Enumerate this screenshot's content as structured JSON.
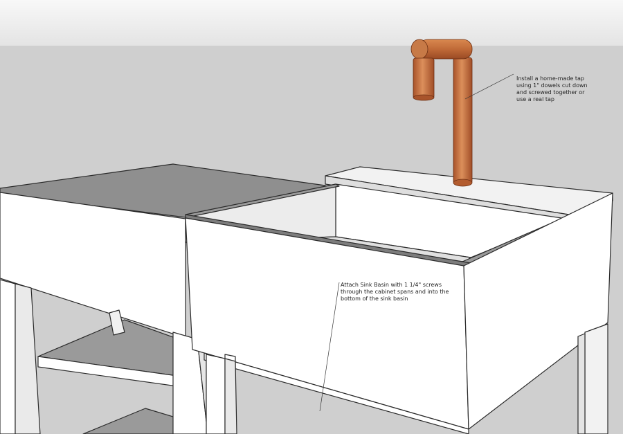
{
  "annotations": {
    "tap": {
      "lines": [
        "Install a home-made tap",
        "using 1\" dowels cut down",
        "and screwed together or",
        "use a real tap"
      ]
    },
    "basin": {
      "lines": [
        "Attach Sink Basin with 1 1/4\" screws",
        "through the cabinet spans and into the",
        "bottom of the sink basin"
      ]
    }
  },
  "colors": {
    "sky_top": "#f7f7f7",
    "sky_bottom": "#e6e6e6",
    "ground": "#cdcdcd",
    "white_face": "#ffffff",
    "shade_face": "#ececec",
    "dark_face": "#8e8e8e",
    "edge": "#2a2a2a",
    "wood_light": "#d88a55",
    "wood_dark": "#9a4a24"
  }
}
